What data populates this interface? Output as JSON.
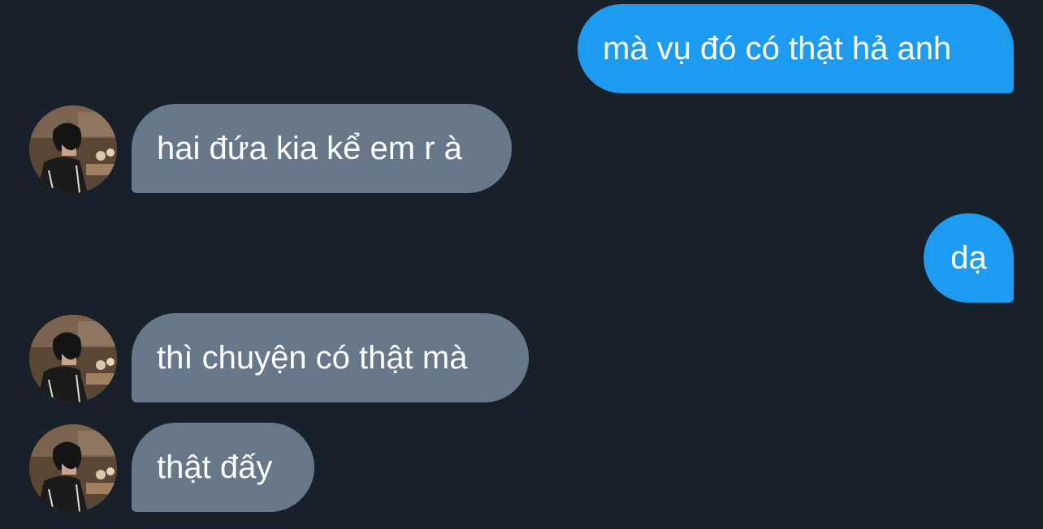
{
  "conversation": {
    "messages": [
      {
        "direction": "sent",
        "text": "mà vụ đó có thật hả anh"
      },
      {
        "direction": "received",
        "text": "hai đứa kia kể em r à"
      },
      {
        "direction": "sent",
        "text": "dạ"
      },
      {
        "direction": "received",
        "text": "thì chuyện có thật mà"
      },
      {
        "direction": "received",
        "text": "thật đấy"
      }
    ]
  },
  "colors": {
    "background": "#18202a",
    "sent_bubble": "#1d9bf0",
    "received_bubble": "#66788a",
    "text": "#ffffff"
  },
  "icons": {
    "avatar": "avatar-icon"
  }
}
